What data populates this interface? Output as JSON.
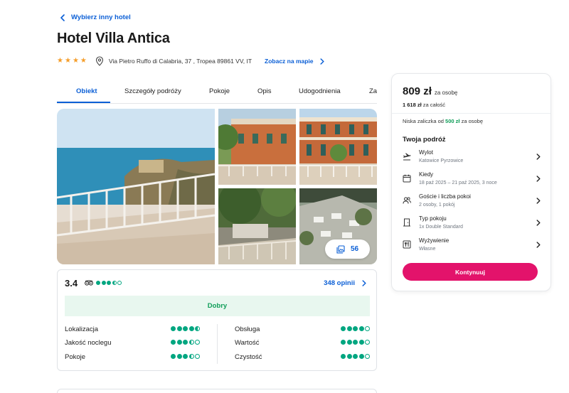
{
  "nav": {
    "back_label": "Wybierz inny hotel"
  },
  "hotel": {
    "name": "Hotel Villa Antica",
    "stars": 4,
    "address": "Via Pietro Ruffo di Calabria, 37 , Tropea 89861 VV, IT",
    "map_link": "Zobacz na mapie"
  },
  "tabs": [
    {
      "label": "Obiekt",
      "active": true
    },
    {
      "label": "Szczegóły podróży",
      "active": false
    },
    {
      "label": "Pokoje",
      "active": false
    },
    {
      "label": "Opis",
      "active": false
    },
    {
      "label": "Udogodnienia",
      "active": false
    },
    {
      "label": "Za",
      "active": false
    }
  ],
  "gallery": {
    "photo_count": "56"
  },
  "rating": {
    "score": "3.4",
    "tripadvisor_bubbles": 3.5,
    "opinions_label": "348 opinii",
    "verdict": "Dobry",
    "criteria": [
      {
        "label": "Lokalizacja",
        "bubbles": 4.5
      },
      {
        "label": "Obsługa",
        "bubbles": 4
      },
      {
        "label": "Jakość noclegu",
        "bubbles": 3.5
      },
      {
        "label": "Wartość",
        "bubbles": 4
      },
      {
        "label": "Pokoje",
        "bubbles": 3.5
      },
      {
        "label": "Czystość",
        "bubbles": 4
      }
    ]
  },
  "booking": {
    "price": "809 zł",
    "price_per": "za osobę",
    "total_value": "1 618 zł",
    "total_suffix": "za całość",
    "deposit_prefix": "Niska zaliczka od",
    "deposit_amount": "500 zł",
    "deposit_suffix": "za osobę",
    "trip_heading": "Twoja podróż",
    "rows": [
      {
        "icon": "plane-icon",
        "label": "Wylot",
        "value": "Katowice Pyrzowice"
      },
      {
        "icon": "calendar-icon",
        "label": "Kiedy",
        "value": "18 paź 2025 – 21 paź 2025, 3 noce"
      },
      {
        "icon": "guests-icon",
        "label": "Goście i liczba pokoi",
        "value": "2 osoby, 1 pokój"
      },
      {
        "icon": "door-icon",
        "label": "Typ pokoju",
        "value": "1x Double Standard"
      },
      {
        "icon": "cutlery-icon",
        "label": "Wyżywienie",
        "value": "Własne"
      }
    ],
    "cta": "Kontynuuj"
  },
  "colors": {
    "accent": "#0b5fd6",
    "cta": "#e3136b",
    "rating_green": "#00a680",
    "star": "#f59e2b"
  }
}
